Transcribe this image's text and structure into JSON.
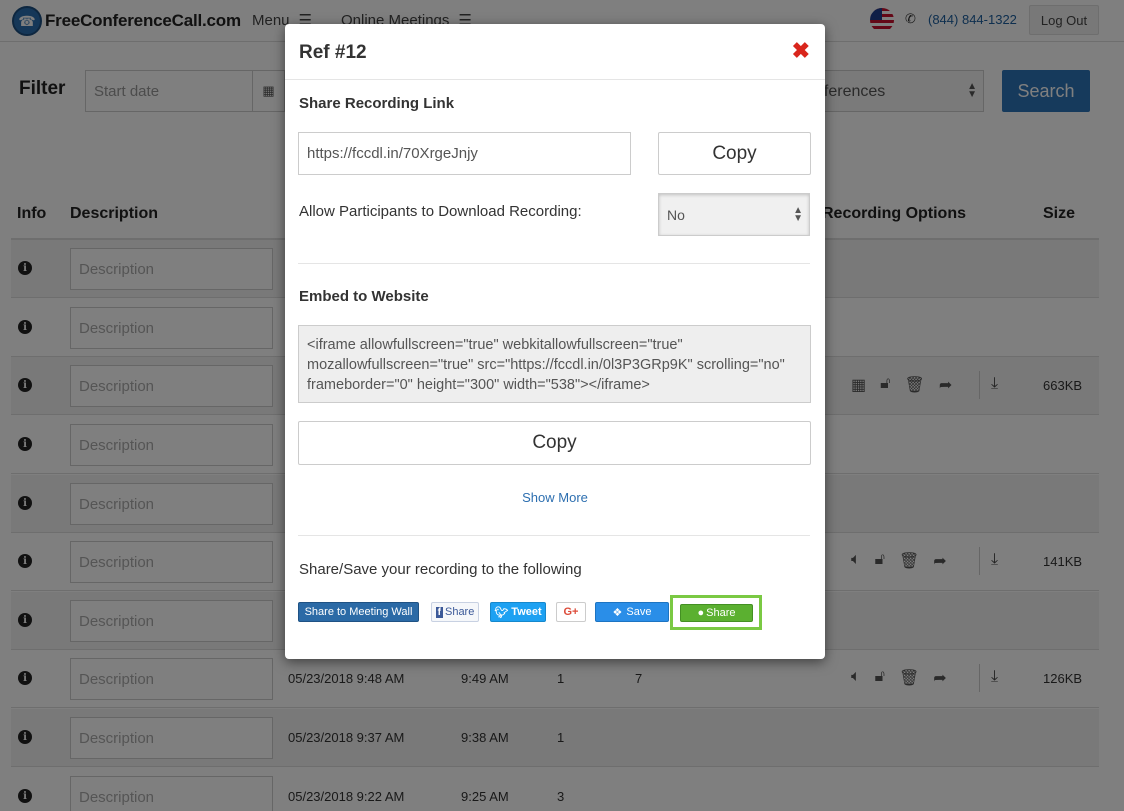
{
  "header": {
    "logo_text": "FreeConferenceCall.com",
    "menu_label": "Menu",
    "online_meetings_label": "Online Meetings",
    "phone": "(844) 844-1322",
    "logout_label": "Log Out"
  },
  "filter": {
    "label": "Filter",
    "start_date_placeholder": "Start date",
    "conference_select_value": "nferences",
    "search_label": "Search"
  },
  "table": {
    "headers": {
      "info": "Info",
      "description": "Description",
      "recording_options": "Recording Options",
      "size": "Size"
    },
    "description_placeholder": "Description",
    "rows": [
      {
        "date": "",
        "end": "",
        "participants": "",
        "minutes": "",
        "size": ""
      },
      {
        "date": "",
        "end": "",
        "participants": "",
        "minutes": "",
        "size": ""
      },
      {
        "date": "",
        "end": "",
        "participants": "",
        "minutes": "",
        "size": "663KB"
      },
      {
        "date": "",
        "end": "",
        "participants": "",
        "minutes": "",
        "size": ""
      },
      {
        "date": "",
        "end": "",
        "participants": "",
        "minutes": "",
        "size": ""
      },
      {
        "date": "",
        "end": "",
        "participants": "",
        "minutes": "",
        "size": "141KB"
      },
      {
        "date": "",
        "end": "",
        "participants": "",
        "minutes": "",
        "size": ""
      },
      {
        "date": "05/23/2018 9:48 AM",
        "end": "9:49 AM",
        "participants": "1",
        "minutes": "7",
        "size": "126KB"
      },
      {
        "date": "05/23/2018 9:37 AM",
        "end": "9:38 AM",
        "participants": "1",
        "minutes": "",
        "size": ""
      },
      {
        "date": "05/23/2018 9:22 AM",
        "end": "9:25 AM",
        "participants": "3",
        "minutes": "",
        "size": ""
      }
    ]
  },
  "modal": {
    "title": "Ref #12",
    "share_link_title": "Share Recording Link",
    "share_link_value": "https://fccdl.in/70XrgeJnjy",
    "copy_label": "Copy",
    "allow_download_label": "Allow Participants to Download Recording:",
    "allow_download_value": "No",
    "embed_title": "Embed to Website",
    "embed_code": "<iframe allowfullscreen=\"true\" webkitallowfullscreen=\"true\" mozallowfullscreen=\"true\" src=\"https://fccdl.in/0l3P3GRp9K\" scrolling=\"no\" frameborder=\"0\" height=\"300\" width=\"538\"></iframe>",
    "embed_copy_label": "Copy",
    "show_more_label": "Show More",
    "share_save_text": "Share/Save your recording to the following",
    "share_buttons": {
      "meeting_wall": "Share to Meeting Wall",
      "facebook": "Share",
      "twitter": "Tweet",
      "google_plus": "G+",
      "dropbox": "Save",
      "evernote": "Share"
    }
  },
  "colors": {
    "accent": "#2d74b8",
    "close": "#d9261c",
    "highlight": "#7ac943"
  }
}
